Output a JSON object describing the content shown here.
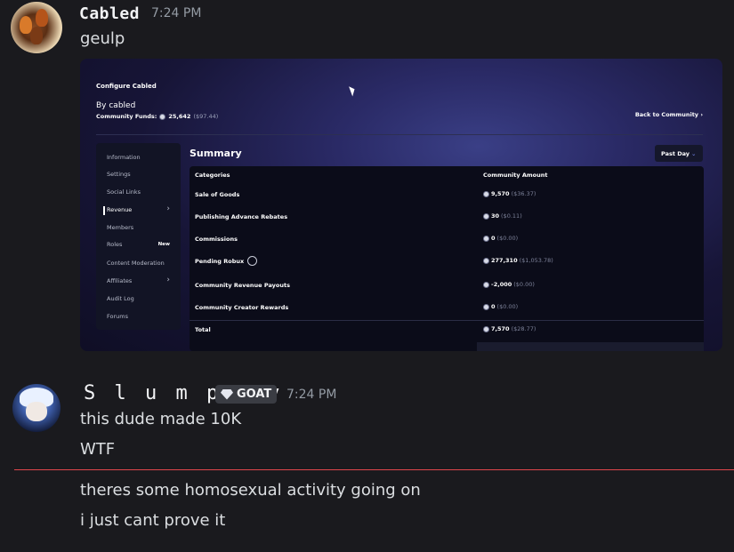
{
  "messages": [
    {
      "username": "Cabled",
      "timestamp": "7:24 PM",
      "lines": [
        "geulp"
      ]
    },
    {
      "username": "S l u m p p y",
      "badge": "GOAT",
      "timestamp": "7:24 PM",
      "lines": [
        "this dude made 10K",
        "WTF",
        "theres some homosexual activity going on",
        "i just cant prove it"
      ]
    }
  ],
  "embed": {
    "title": "Configure Cabled",
    "by": "By cabled",
    "funds_label": "Community Funds:",
    "funds_amount": "25,642",
    "funds_usd": "($97.44)",
    "back_link": "Back to Community",
    "sidebar": [
      "Information",
      "Settings",
      "Social Links",
      "Revenue",
      "Members",
      "Roles",
      "Content Moderation",
      "Affiliates",
      "Audit Log",
      "Forums"
    ],
    "roles_badge": "New",
    "summary_title": "Summary",
    "period": "Past Day",
    "col_categories": "Categories",
    "col_amount": "Community Amount",
    "rows": [
      {
        "label": "Sale of Goods",
        "amount": "9,570",
        "usd": "($36.37)"
      },
      {
        "label": "Publishing Advance Rebates",
        "amount": "30",
        "usd": "($0.11)"
      },
      {
        "label": "Commissions",
        "amount": "0",
        "usd": "($0.00)"
      },
      {
        "label": "Pending Robux",
        "amount": "277,310",
        "usd": "($1,053.78)"
      },
      {
        "label": "Community Revenue Payouts",
        "amount": "-2,000",
        "usd": "($0.00)"
      },
      {
        "label": "Community Creator Rewards",
        "amount": "0",
        "usd": "($0.00)"
      },
      {
        "label": "Total",
        "amount": "7,570",
        "usd": "($28.77)"
      }
    ]
  },
  "colors": {
    "background": "#1a1a1e",
    "divider": "#e0474c",
    "badge_bg": "#3a3c43"
  }
}
